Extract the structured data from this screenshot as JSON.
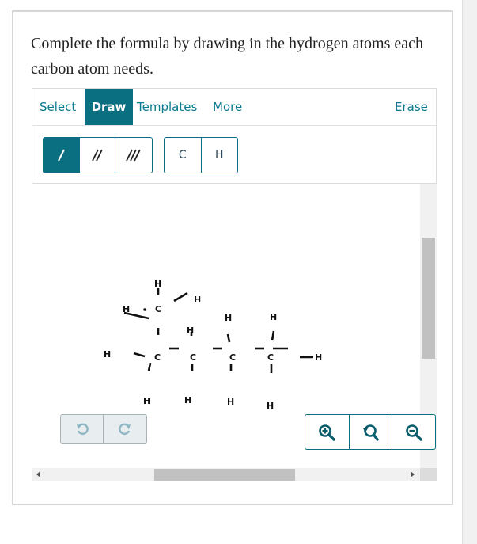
{
  "question": {
    "text": "Complete the formula by drawing in the hydrogen atoms each carbon atom needs."
  },
  "toolbar": {
    "tabs": [
      {
        "label": "Select",
        "active": false
      },
      {
        "label": "Draw",
        "active": true
      },
      {
        "label": "Templates",
        "active": false
      },
      {
        "label": "More",
        "active": false
      }
    ],
    "erase_label": "Erase",
    "bonds": [
      "single-bond-icon",
      "double-bond-icon",
      "triple-bond-icon"
    ],
    "atoms": [
      "C",
      "H"
    ]
  },
  "molecule": {
    "carbons": [
      "C",
      "C",
      "C",
      "C",
      "C"
    ],
    "hydrogens": [
      "H",
      "H",
      "H",
      "H",
      "H",
      "H",
      "H",
      "H",
      "H",
      "H",
      "H",
      "H"
    ]
  },
  "colors": {
    "accent": "#0a6f80",
    "link": "#0a7a8c"
  }
}
